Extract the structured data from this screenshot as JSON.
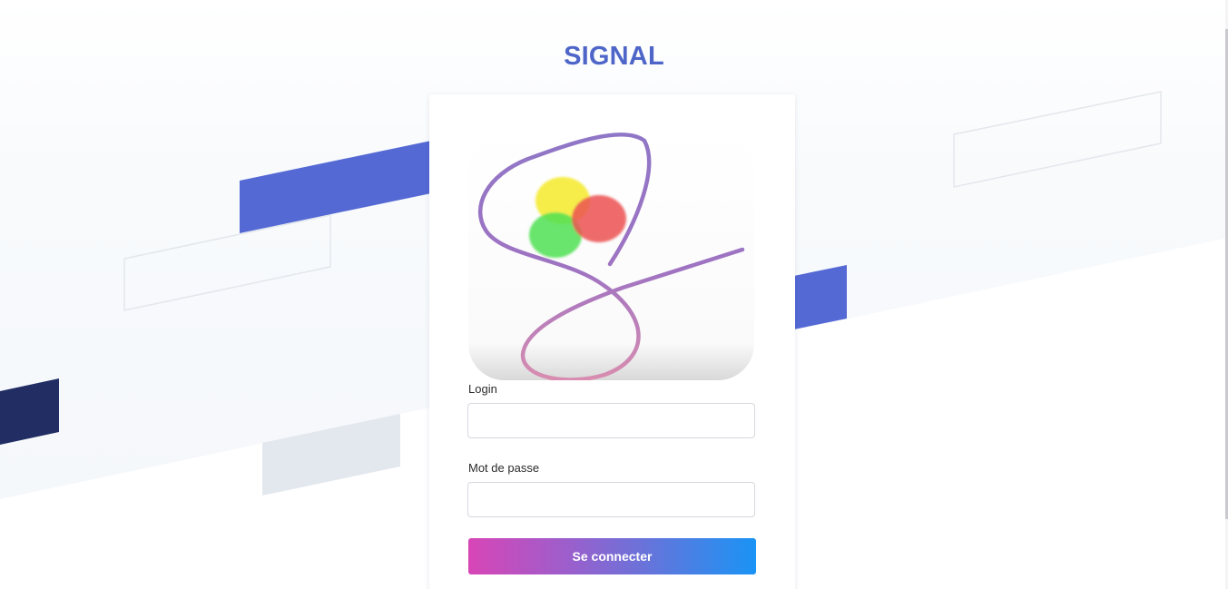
{
  "header": {
    "title": "SIGNAL"
  },
  "login_form": {
    "logo_icon": "signal-logo-icon",
    "login_label": "Login",
    "login_value": "",
    "password_label": "Mot de passe",
    "password_value": "",
    "submit_label": "Se connecter"
  },
  "colors": {
    "brand": "#4f66c9",
    "accent_blue": "#5469d4",
    "dark_navy": "#212d63",
    "button_gradient_start": "#d845b6",
    "button_gradient_end": "#1a94f5"
  }
}
